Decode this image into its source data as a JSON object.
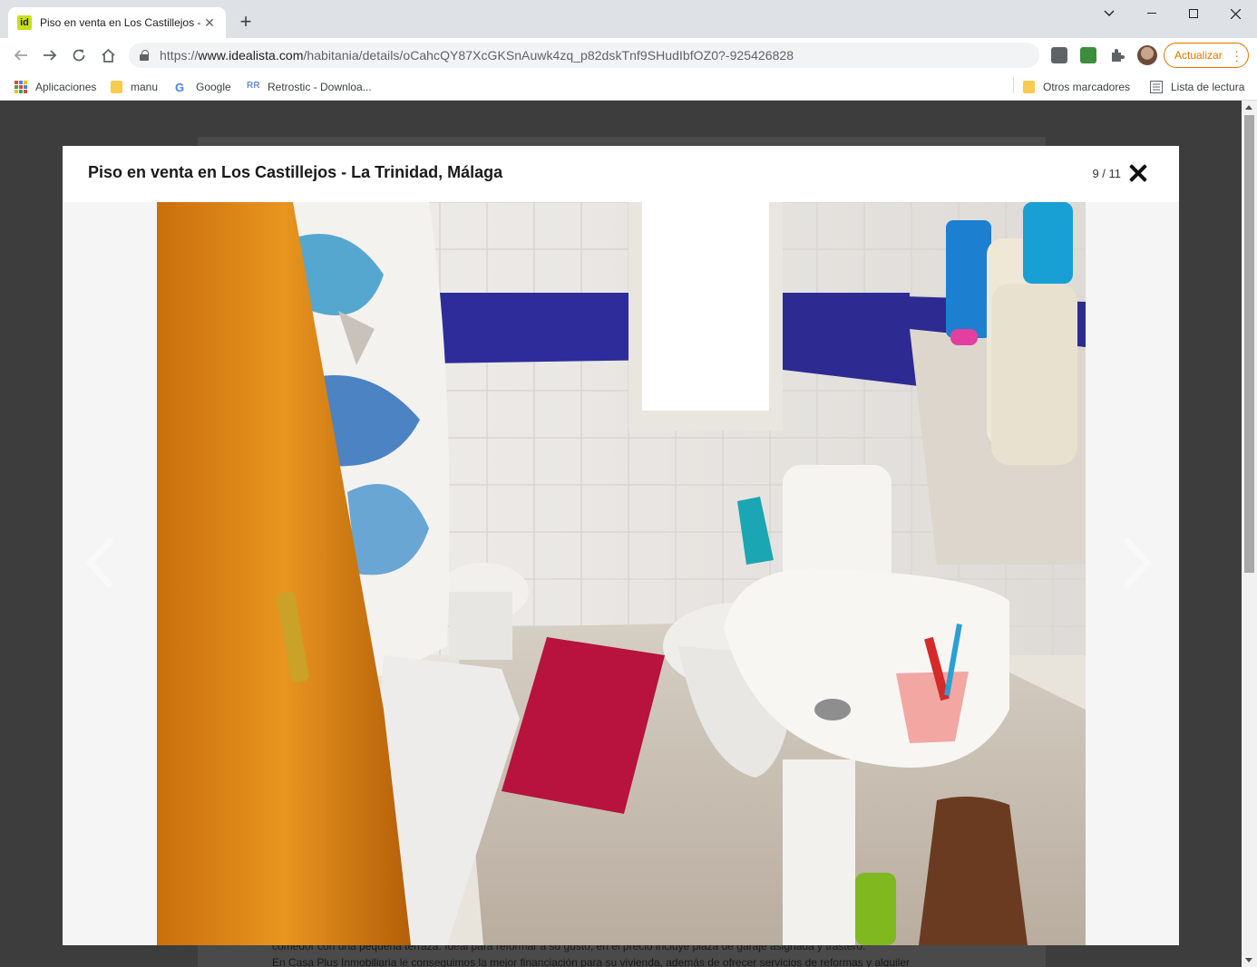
{
  "browser": {
    "tab": {
      "title": "Piso en venta en Los Castillejos - ",
      "favicon_text": "id"
    },
    "address": {
      "scheme": "https://",
      "host": "www.idealista.com",
      "path": "/habitania/details/oCahcQY87XcGKSnAuwk4zq_p82dskTnf9SHudIbfOZ0?-925426828"
    },
    "update_label": "Actualizar",
    "bookmarks": {
      "apps": "Aplicaciones",
      "manu": "manu",
      "google": "Google",
      "retrostic": "Retrostic - Downloa...",
      "other": "Otros marcadores",
      "reading_list": "Lista de lectura"
    }
  },
  "page": {
    "background_text_1": "comedor con una pequeña terraza. Ideal para reformar a su gusto, en el precio incluye plaza de garaje asignada y trastero.",
    "background_text_2": "En Casa Plus Inmobiliaria le conseguimos la mejor financiación para su vivienda, además de ofrecer servicios de reformas y alquiler"
  },
  "gallery": {
    "title": "Piso en venta en Los Castillejos - La Trinidad, Málaga",
    "counter": "9 / 11",
    "photo_alt": "bathroom-photo"
  },
  "colors": {
    "accent_orange": "#e37400",
    "modal_bg": "#ffffff",
    "overlay": "#3d3d3d"
  }
}
